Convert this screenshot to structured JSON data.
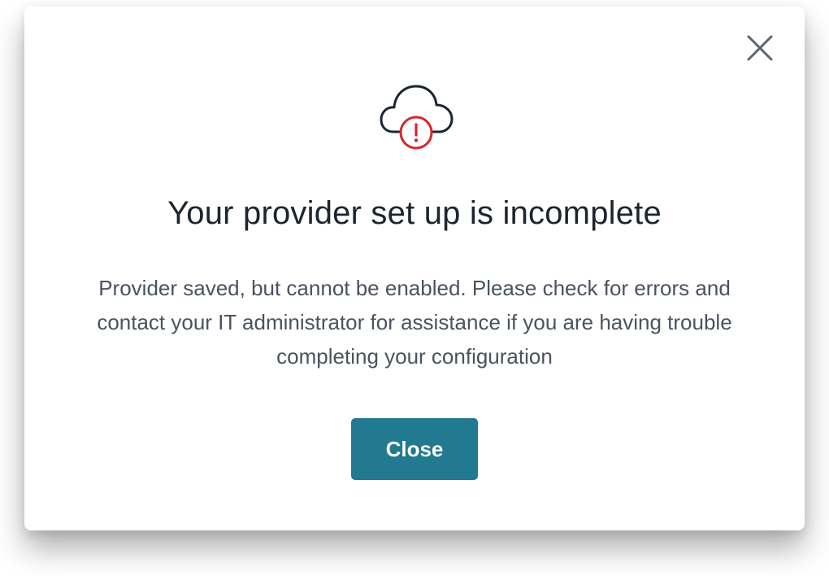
{
  "dialog": {
    "title": "Your provider set up is incomplete",
    "message": "Provider saved, but cannot be enabled. Please check for errors and contact your IT administrator for assistance if you are having trouble completing your configuration",
    "close_button_label": "Close",
    "icons": {
      "header": "cloud-error-icon",
      "dismiss": "close-icon"
    },
    "colors": {
      "primary": "#217a8f",
      "error": "#d62828",
      "heading": "#1c2530",
      "body_text": "#4a5360"
    }
  }
}
